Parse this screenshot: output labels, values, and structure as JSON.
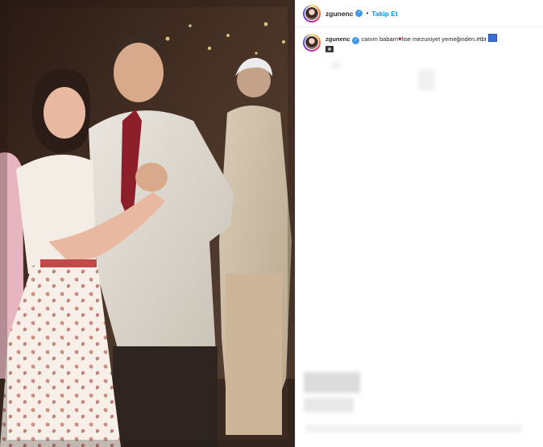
{
  "post": {
    "username": "zgunenc",
    "verified_icon": "verified-badge-icon",
    "separator": "•",
    "follow_label": "Takip Et",
    "caption": {
      "username": "zgunenc",
      "part1": " canım babam",
      "heart": "♥",
      "part2": "lise mezuniyet yemeğinden.#tbt"
    }
  },
  "colors": {
    "follow_blue": "#0095f6",
    "verified_blue": "#3897f0",
    "text": "#262626"
  },
  "photo": {
    "description_icon": "photo-image"
  }
}
